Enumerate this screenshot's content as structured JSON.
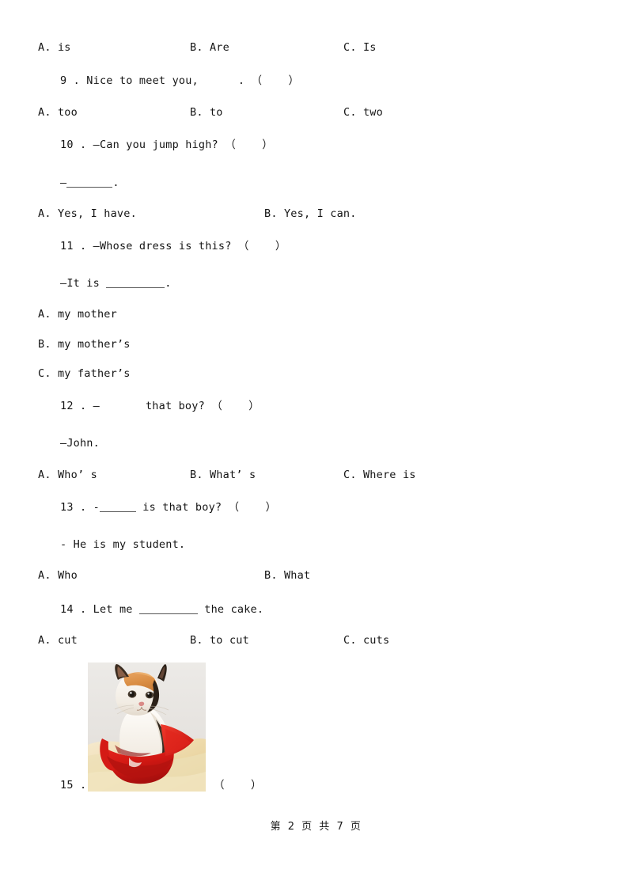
{
  "page": {
    "footer": "第 2 页 共 7 页",
    "page_number": "2",
    "total_pages": "7",
    "background_color": "#ffffff",
    "text_color": "#1a1a1a"
  },
  "questions": [
    {
      "id": "q8-options",
      "type": "options-row",
      "layout": "three-column",
      "options": [
        {
          "label": "A. is"
        },
        {
          "label": "B. Are"
        },
        {
          "label": "C. Is"
        }
      ]
    },
    {
      "id": "q9",
      "type": "stem",
      "number": "9",
      "text_before": "9 . Nice to meet you,",
      "text_after": ". （    ）",
      "marker": "（    ）"
    },
    {
      "id": "q9-options",
      "type": "options-row",
      "layout": "three-column",
      "options": [
        {
          "label": "A. too"
        },
        {
          "label": "B. to"
        },
        {
          "label": "C. two"
        }
      ]
    },
    {
      "id": "q10",
      "type": "stem",
      "number": "10",
      "text": "10 . —Can you jump high? （    ）"
    },
    {
      "id": "q10-answer",
      "type": "answer-line",
      "text_before": "—",
      "text_after": "."
    },
    {
      "id": "q10-options",
      "type": "options-row",
      "layout": "two-column",
      "options": [
        {
          "label": "A. Yes, I have."
        },
        {
          "label": "B. Yes, I can."
        }
      ]
    },
    {
      "id": "q11",
      "type": "stem",
      "number": "11",
      "text": "11 . —Whose dress is this? （    ）"
    },
    {
      "id": "q11-answer",
      "type": "answer-line",
      "text_before": "—It is",
      "text_after": "."
    },
    {
      "id": "q11-options",
      "type": "options-stacked",
      "options": [
        {
          "label": "A. my mother"
        },
        {
          "label": "B. my mother’s"
        },
        {
          "label": "C. my father’s"
        }
      ]
    },
    {
      "id": "q12",
      "type": "stem",
      "number": "12",
      "text_before": "12 . —",
      "text_after": "that boy? （    ）"
    },
    {
      "id": "q12-answer",
      "type": "answer-line-plain",
      "text": "—John."
    },
    {
      "id": "q12-options",
      "type": "options-row",
      "layout": "three-column",
      "options": [
        {
          "label": "A. Who’ s"
        },
        {
          "label": "B. What’ s"
        },
        {
          "label": "C. Where is"
        }
      ]
    },
    {
      "id": "q13",
      "type": "stem",
      "number": "13",
      "text_before": "13 . -",
      "text_after": "is that boy? （    ）"
    },
    {
      "id": "q13-answer",
      "type": "answer-line-plain",
      "text": "- He is my student."
    },
    {
      "id": "q13-options",
      "type": "options-row",
      "layout": "two-column",
      "options": [
        {
          "label": "A. Who"
        },
        {
          "label": "B. What"
        }
      ]
    },
    {
      "id": "q14",
      "type": "stem",
      "number": "14",
      "text_before": "14 . Let me",
      "text_after": "the cake."
    },
    {
      "id": "q14-options",
      "type": "options-row",
      "layout": "three-column",
      "options": [
        {
          "label": "A. cut"
        },
        {
          "label": "B. to cut"
        },
        {
          "label": "C. cuts"
        }
      ]
    },
    {
      "id": "q15",
      "type": "stem-with-image",
      "number": "15",
      "text_before": "15 .",
      "marker": "（    ）",
      "image": {
        "alt": "calico kitten sitting in a red bag on a cream fur blanket",
        "colors": {
          "background": "#e9e7e4",
          "bag": "#d61a16",
          "bag_shadow": "#a80f0d",
          "fur_blanket": "#f0dfb4",
          "kitten_orange": "#d79košíku",
          "kitten_white": "#f7f3ee",
          "kitten_black": "#2b2118"
        }
      }
    }
  ]
}
